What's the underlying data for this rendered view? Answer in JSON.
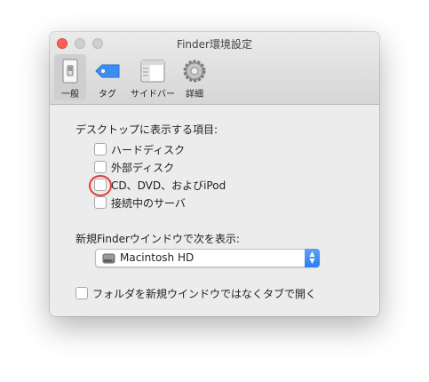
{
  "window": {
    "title": "Finder環境設定"
  },
  "toolbar": {
    "tabs": [
      {
        "label": "一般",
        "icon": "general-switch-icon",
        "selected": true
      },
      {
        "label": "タグ",
        "icon": "tag-icon",
        "selected": false
      },
      {
        "label": "サイドバー",
        "icon": "sidebar-icon",
        "selected": false
      },
      {
        "label": "詳細",
        "icon": "gear-icon",
        "selected": false
      }
    ]
  },
  "desktop": {
    "heading": "デスクトップに表示する項目:",
    "items": [
      {
        "label": "ハードディスク",
        "checked": false
      },
      {
        "label": "外部ディスク",
        "checked": false
      },
      {
        "label": "CD、DVD、およびiPod",
        "checked": false
      },
      {
        "label": "接続中のサーバ",
        "checked": false
      }
    ]
  },
  "new_window": {
    "heading": "新規Finderウインドウで次を表示:",
    "selected": "Macintosh HD"
  },
  "tabs_option": {
    "label": "フォルダを新規ウインドウではなくタブで開く",
    "checked": false
  },
  "colors": {
    "accent": "#2a7ef0",
    "highlight_circle": "#e2383a",
    "close": "#fe5f57"
  }
}
